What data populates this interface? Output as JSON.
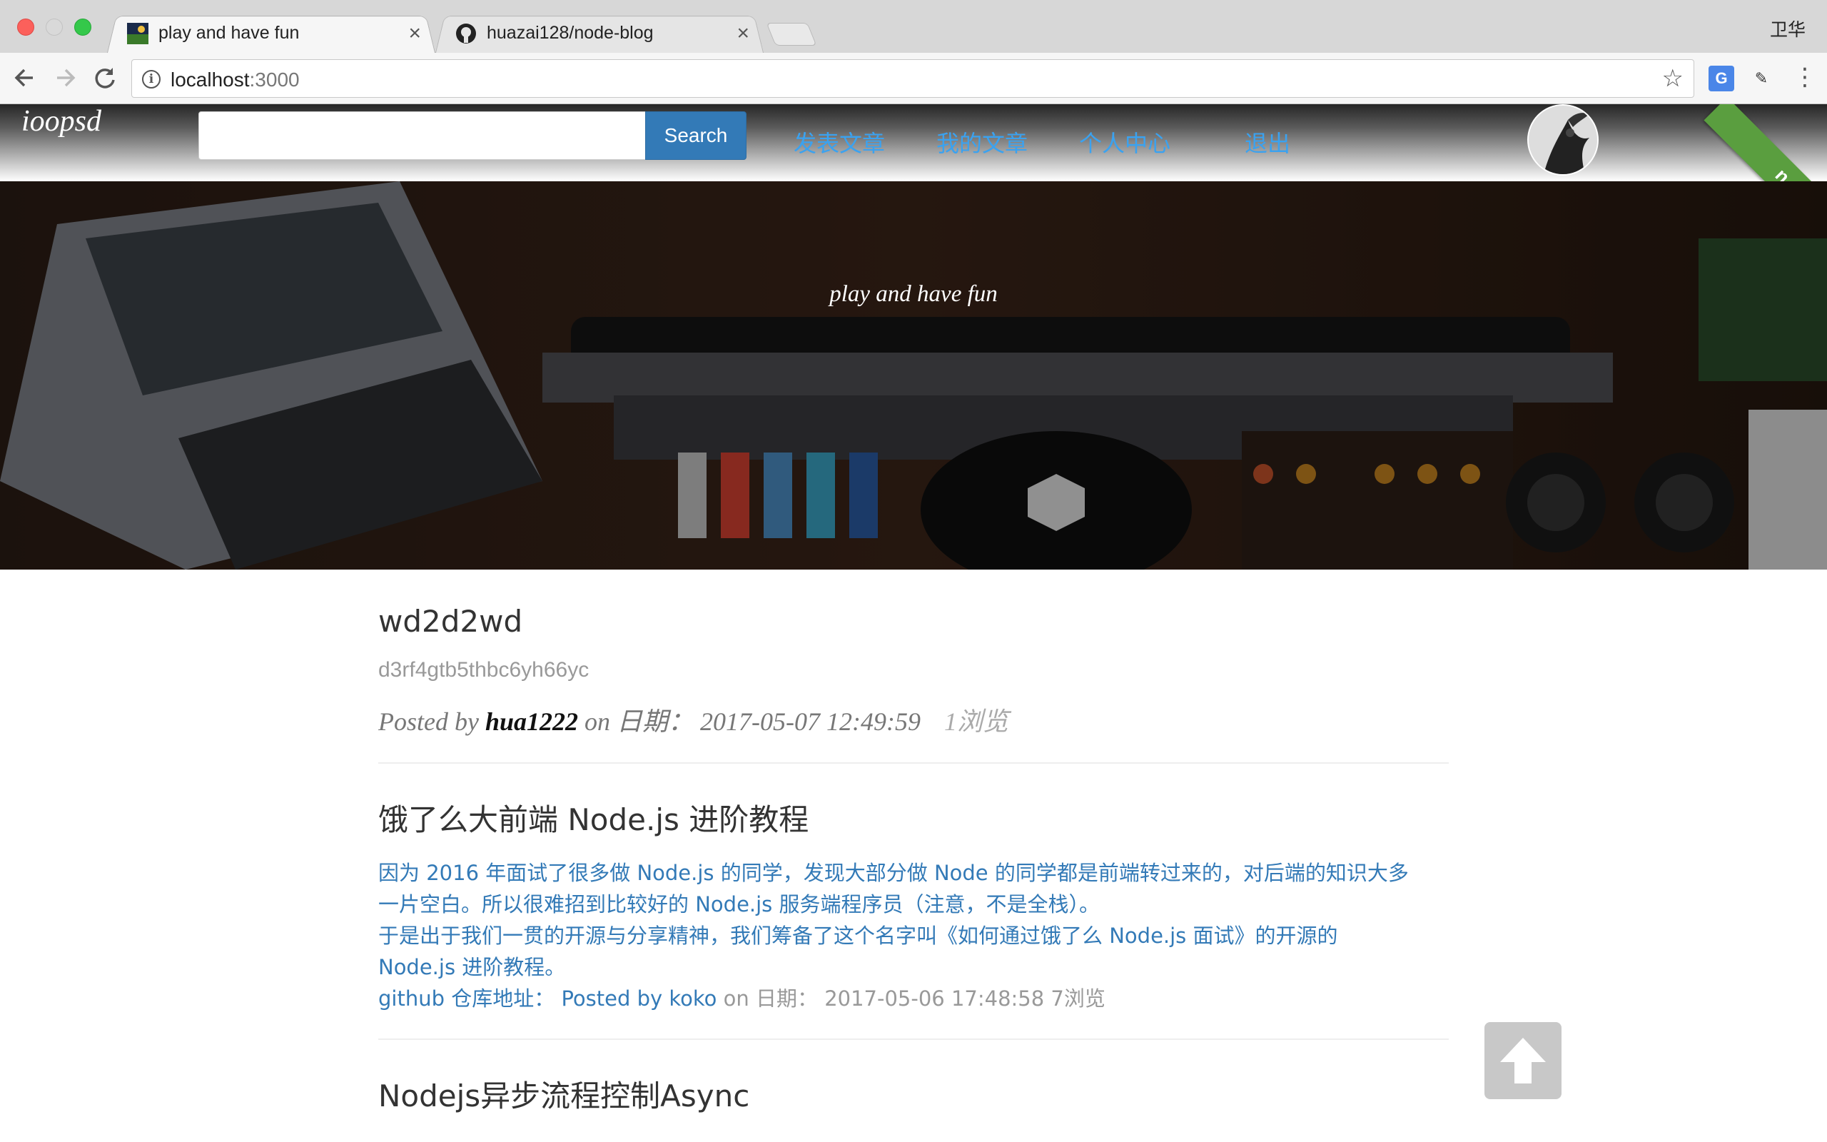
{
  "browser": {
    "tabs": [
      {
        "title": "play and have fun",
        "active": true
      },
      {
        "title": "huazai128/node-blog",
        "active": false
      }
    ],
    "close_glyph": "×",
    "user": "卫华",
    "url_host": "localhost",
    "url_port": ":3000",
    "icons": {
      "back": "back-arrow-icon",
      "forward": "forward-arrow-icon",
      "reload": "reload-icon",
      "info": "info-icon",
      "star": "bookmark-star-icon",
      "translate": "google-translate-icon",
      "dict": "dictionary-extension-icon",
      "menu": "kebab-menu-icon"
    }
  },
  "header": {
    "brand": "ioopsd",
    "search_placeholder": "",
    "search_button": "Search",
    "nav": [
      "发表文章",
      "我的文章",
      "个人中心",
      "退出"
    ],
    "ribbon": "n GitHub"
  },
  "hero": {
    "title": "play and have fun"
  },
  "posts": [
    {
      "title": "wd2d2wd",
      "subtitle": "d3rf4gtb5thbc6yh66yc",
      "meta_posted_by": "Posted by",
      "author": "hua1222",
      "meta_on": "on",
      "date_label": "日期：",
      "date": "2017-05-07 12:49:59",
      "views": "1浏览"
    },
    {
      "title": "饿了么大前端 Node.js 进阶教程",
      "body": [
        "因为 2016 年面试了很多做 Node.js 的同学，发现大部分做 Node 的同学都是前端转过来的，对后端的知识大多",
        "一片空白。所以很难招到比较好的 Node.js 服务端程序员（注意，不是全栈）。",
        "于是出于我们一贯的开源与分享精神，我们筹备了这个名字叫《如何通过饿了么 Node.js 面试》的开源的",
        "Node.js 进阶教程。"
      ],
      "repo_label": "github 仓库地址：",
      "meta_posted_by": "Posted by",
      "author": "koko",
      "meta_on": "on",
      "date_label": "日期：",
      "date": "2017-05-06 17:48:58",
      "views": "7浏览"
    },
    {
      "title": "Nodejs异步流程控制Async"
    }
  ],
  "colors": {
    "link": "#337ab7",
    "nav": "#3aa2f0",
    "search_button": "#337ab7",
    "ribbon": "#5a9e3f"
  }
}
